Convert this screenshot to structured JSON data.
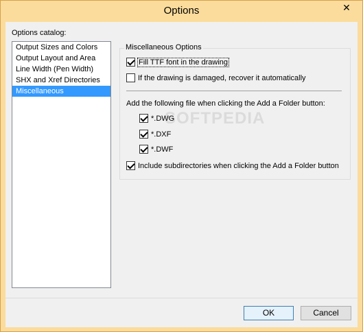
{
  "window": {
    "title": "Options",
    "close_glyph": "✕"
  },
  "catalog": {
    "label": "Options catalog:",
    "items": [
      {
        "label": "Output Sizes and Colors",
        "selected": false
      },
      {
        "label": "Output Layout and Area",
        "selected": false
      },
      {
        "label": "Line Width (Pen Width)",
        "selected": false
      },
      {
        "label": "SHX and Xref Directories",
        "selected": false
      },
      {
        "label": "Miscellaneous",
        "selected": true
      }
    ]
  },
  "misc": {
    "group_caption": "Miscellaneous Options",
    "fill_ttf": {
      "label": "Fill TTF font in the drawing",
      "checked": true
    },
    "recover": {
      "label": "If the drawing is damaged, recover it automatically",
      "checked": false
    },
    "add_folder_label": "Add the following file when clicking the Add a Folder button:",
    "types": [
      {
        "label": "*.DWG",
        "checked": true
      },
      {
        "label": "*.DXF",
        "checked": true
      },
      {
        "label": "*.DWF",
        "checked": true
      }
    ],
    "include_subdirs": {
      "label": "Include subdirectories when clicking the Add a Folder button",
      "checked": true
    }
  },
  "buttons": {
    "ok": "OK",
    "cancel": "Cancel"
  },
  "watermark": "SOFTPEDIA"
}
